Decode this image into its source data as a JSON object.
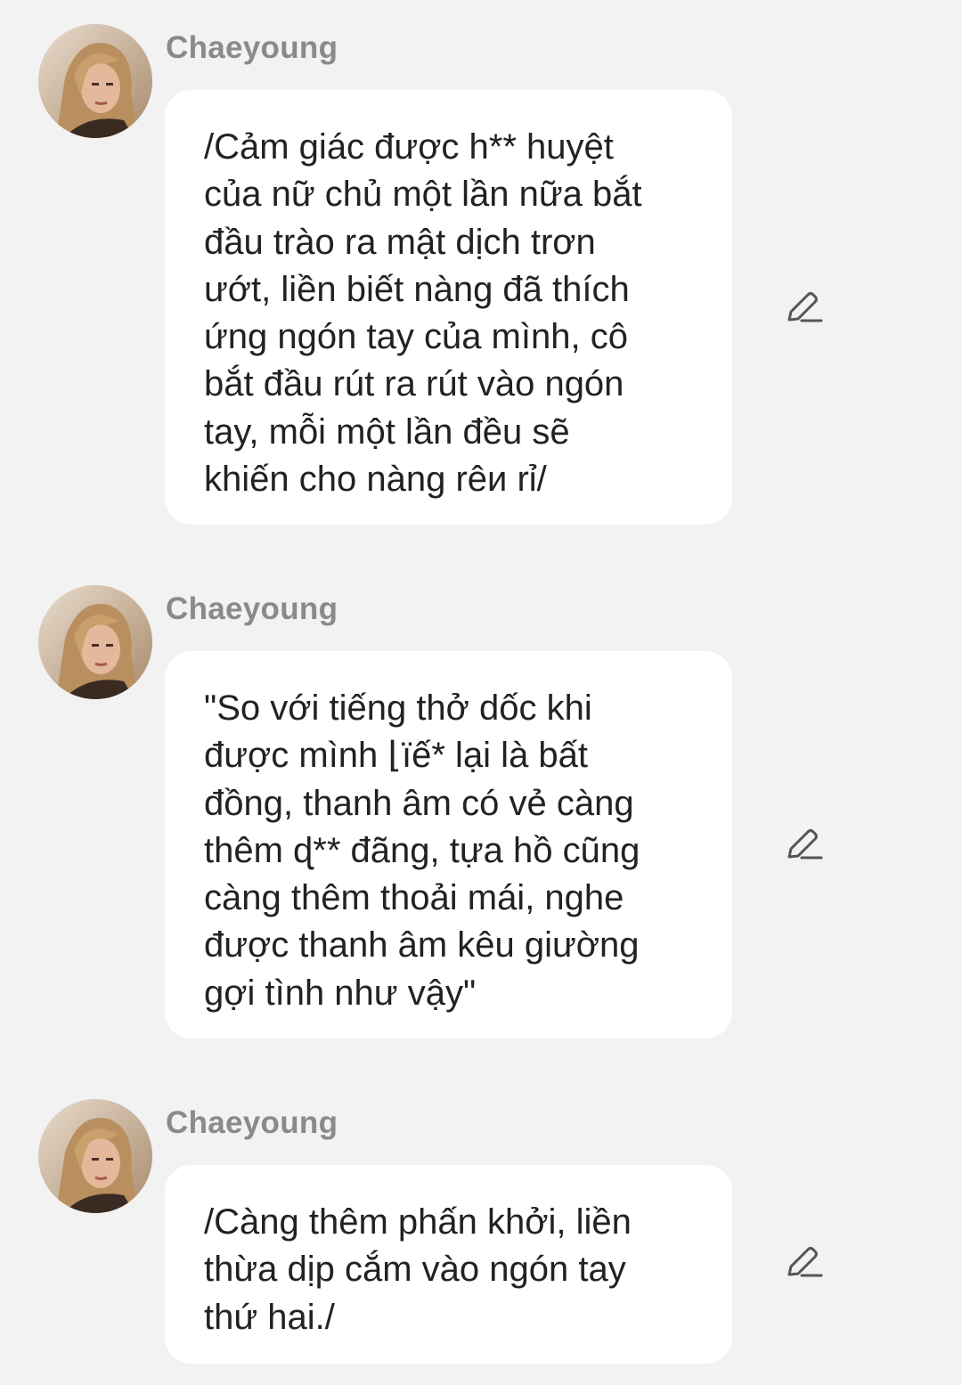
{
  "messages": [
    {
      "sender": "Chaeyoung",
      "text": "/Cảm giác được h** huyệt\ncủa nữ chủ một lần nữa bắt\nđầu trào ra mật dịch trơn\nướt, liền biết nàng đã thích\nứng ngón tay của mình, cô\nbắt đầu rút ra rút vào ngón\ntay, mỗi một lần đều sẽ\nkhiến cho nàng rêи rỉ/",
      "edit_icon": "pencil-edit-icon"
    },
    {
      "sender": "Chaeyoung",
      "text": "\"So với tiếng thở dốc khi\nđược mình ⌊ïế* lại là bất\nđồng, thanh âm có vẻ càng\nthêm ɖ** đãng, tựa hồ cũng\ncàng thêm thoải mái, nghe\nđược thanh âm kêu giường\ngợi tình như vậy\"",
      "edit_icon": "pencil-edit-icon"
    },
    {
      "sender": "Chaeyoung",
      "text": "/Càng thêm phấn khởi, liền\nthừa dịp cắm vào ngón tay\nthứ hai./",
      "edit_icon": "pencil-edit-icon"
    }
  ],
  "colors": {
    "background": "#f2f2f2",
    "bubble": "#ffffff",
    "sender_name": "#8a8a8a",
    "message_text": "#222222",
    "icon": "#555555"
  }
}
